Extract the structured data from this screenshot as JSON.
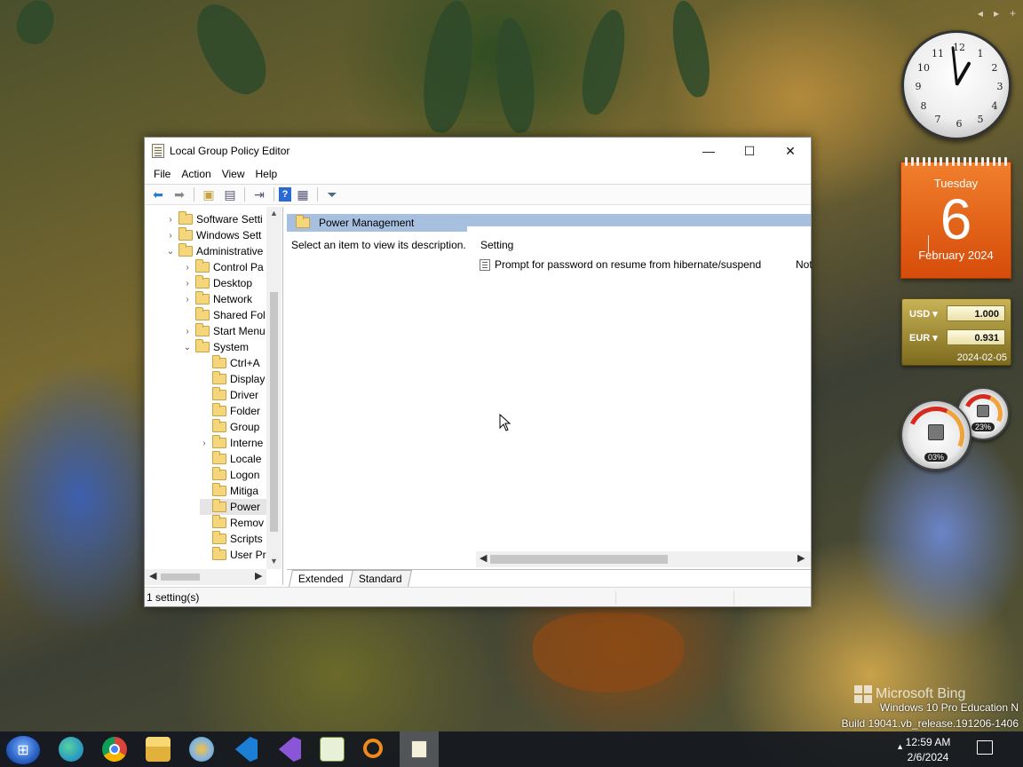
{
  "window": {
    "title": "Local Group Policy Editor",
    "controls": {
      "minimize": "—",
      "maximize": "☐",
      "close": "✕"
    }
  },
  "menu": [
    "File",
    "Action",
    "View",
    "Help"
  ],
  "tree": {
    "items": [
      {
        "label": "Software Setti",
        "chevron": "›"
      },
      {
        "label": "Windows Sett",
        "chevron": "›"
      },
      {
        "label": "Administrative",
        "chevron": "⌄"
      },
      {
        "label": "Control Pa",
        "chevron": "›"
      },
      {
        "label": "Desktop",
        "chevron": "›"
      },
      {
        "label": "Network",
        "chevron": "›"
      },
      {
        "label": "Shared Fol",
        "chevron": ""
      },
      {
        "label": "Start Menu",
        "chevron": "›"
      },
      {
        "label": "System",
        "chevron": "⌄"
      },
      {
        "label": "Ctrl+A",
        "chevron": ""
      },
      {
        "label": "Display",
        "chevron": ""
      },
      {
        "label": "Driver",
        "chevron": ""
      },
      {
        "label": "Folder",
        "chevron": ""
      },
      {
        "label": "Group",
        "chevron": ""
      },
      {
        "label": "Interne",
        "chevron": "›"
      },
      {
        "label": "Locale",
        "chevron": ""
      },
      {
        "label": "Logon",
        "chevron": ""
      },
      {
        "label": "Mitiga",
        "chevron": ""
      },
      {
        "label": "Power",
        "chevron": ""
      },
      {
        "label": "Remov",
        "chevron": ""
      },
      {
        "label": "Scripts",
        "chevron": ""
      },
      {
        "label": "User Pr",
        "chevron": ""
      }
    ]
  },
  "right_pane": {
    "header": "Power Management",
    "description": "Select an item to view its description.",
    "column_setting": "Setting",
    "rows": [
      {
        "setting": "Prompt for password on resume from hibernate/suspend",
        "state": "Not"
      }
    ]
  },
  "tabs": [
    "Extended",
    "Standard"
  ],
  "status": "1 setting(s)",
  "gadgets": {
    "clock_numbers": [
      "12",
      "1",
      "2",
      "3",
      "4",
      "5",
      "6",
      "7",
      "8",
      "9",
      "10",
      "11"
    ],
    "calendar": {
      "weekday": "Tuesday",
      "day": "6",
      "month": "February 2024"
    },
    "currency": {
      "rows": [
        {
          "code": "USD",
          "value": "1.000"
        },
        {
          "code": "EUR",
          "value": "0.931"
        }
      ],
      "date": "2024-02-05"
    },
    "meters": [
      {
        "pct": "03%"
      },
      {
        "pct": "23%"
      }
    ]
  },
  "watermark": {
    "brand": "Microsoft Bing",
    "line1": "Windows 10 Pro Education N",
    "line2": "Build 19041.vb_release.191206-1406"
  },
  "taskbar": {
    "time": "12:59 AM",
    "date": "2/6/2024",
    "icons": [
      "edge-icon",
      "chrome-icon",
      "file-explorer-icon",
      "paint-icon",
      "vscode-icon",
      "visual-studio-icon",
      "notepadpp-icon",
      "search-tool-icon",
      "policy-editor-icon"
    ]
  },
  "colors": {
    "selection_header": "#a7c0e0",
    "calendar": "#e5621a"
  }
}
